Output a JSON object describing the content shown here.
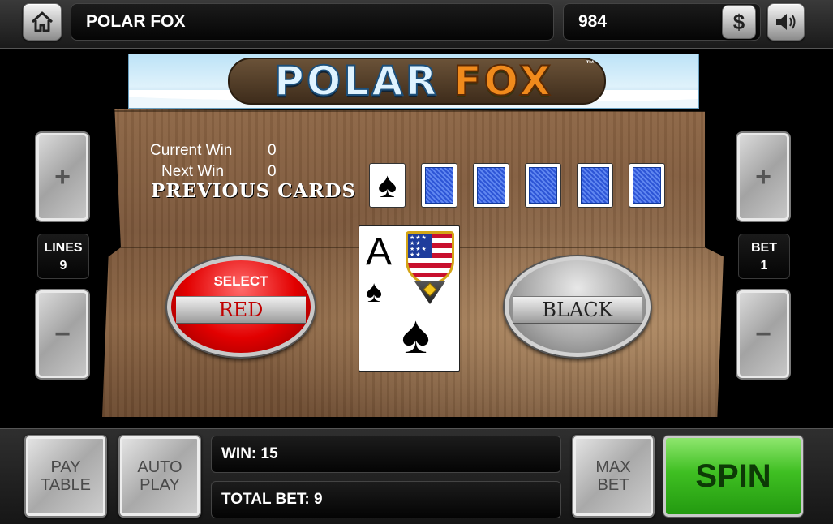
{
  "header": {
    "game_title": "POLAR FOX",
    "balance": "984",
    "currency_symbol": "$"
  },
  "banner": {
    "title_part1": "POLAR",
    "title_part2": "FOX",
    "trademark": "™"
  },
  "gamble": {
    "current_win_label": "Current Win",
    "current_win_value": "0",
    "next_win_label": "Next Win",
    "next_win_value": "0",
    "previous_cards_label": "PREVIOUS CARDS",
    "previous_cards": [
      "♠"
    ],
    "card_backs_count": 5,
    "current_card": {
      "rank": "A",
      "suit": "♠"
    },
    "select_label": "SELECT",
    "red_label": "RED",
    "black_label": "BLACK"
  },
  "left_panel": {
    "plus": "+",
    "minus": "−",
    "lines_label": "LINES",
    "lines_value": "9"
  },
  "right_panel": {
    "plus": "+",
    "minus": "−",
    "bet_label": "BET",
    "bet_value": "1"
  },
  "footer": {
    "pay_table": "PAY\nTABLE",
    "auto_play": "AUTO\nPLAY",
    "win_label": "WIN:",
    "win_value": "15",
    "total_bet_label": "TOTAL BET:",
    "total_bet_value": "9",
    "max_bet": "MAX\nBET",
    "spin": "SPIN"
  },
  "icons": {
    "home": "home-icon",
    "dollar": "dollar-icon",
    "sound": "speaker-icon"
  }
}
